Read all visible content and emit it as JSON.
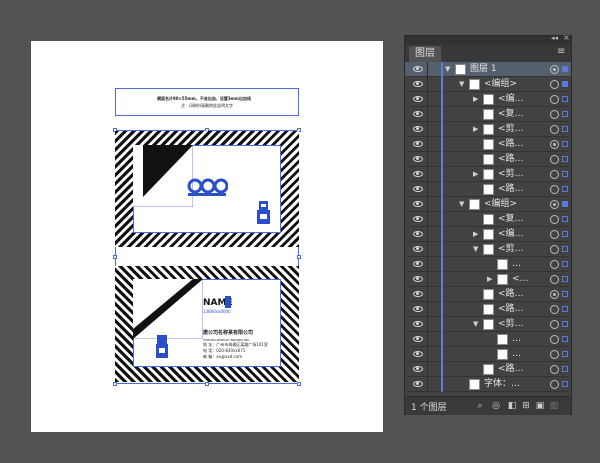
{
  "artboard": {
    "header_line1": "横版名片90×55mm，不含出血，设置3mm出血线",
    "header_line2": "注：印刷时请删除此说明文字",
    "card_name": "NAME",
    "card_phone_top": "13800xx0000",
    "company": "唐公司名称某有限公司",
    "company_en": "CERTAIN JEWELRY BRANDS INC.",
    "address": "地 址：广州市海珠区某路广场101室",
    "phone": "电 话：020-830xx671",
    "email": "邮 箱：xx@xxd.com"
  },
  "panel": {
    "topbar_left": "◂◂",
    "topbar_close": "×",
    "tab_label": "图层",
    "menu_icon": "≡",
    "layers": [
      {
        "name": "图层 1",
        "indent": 0,
        "arrow": "▼",
        "selected": true,
        "target": "filled",
        "sq": "filled"
      },
      {
        "name": "<编组>",
        "indent": 1,
        "arrow": "▼",
        "selected": false,
        "target": "empty",
        "sq": "filled"
      },
      {
        "name": "<编…",
        "indent": 2,
        "arrow": "▶",
        "selected": false,
        "target": "empty",
        "sq": "empty"
      },
      {
        "name": "<复…",
        "indent": 2,
        "arrow": "",
        "selected": false,
        "target": "empty",
        "sq": "empty"
      },
      {
        "name": "<剪…",
        "indent": 2,
        "arrow": "▶",
        "selected": false,
        "target": "empty",
        "sq": "empty"
      },
      {
        "name": "<路…",
        "indent": 2,
        "arrow": "",
        "selected": false,
        "target": "filled",
        "sq": "empty"
      },
      {
        "name": "<路…",
        "indent": 2,
        "arrow": "",
        "selected": false,
        "target": "empty",
        "sq": "empty"
      },
      {
        "name": "<剪…",
        "indent": 2,
        "arrow": "▶",
        "selected": false,
        "target": "empty",
        "sq": "empty"
      },
      {
        "name": "<路…",
        "indent": 2,
        "arrow": "",
        "selected": false,
        "target": "empty",
        "sq": "empty"
      },
      {
        "name": "<编组>",
        "indent": 1,
        "arrow": "▼",
        "selected": false,
        "target": "filled",
        "sq": "filled"
      },
      {
        "name": "<复…",
        "indent": 2,
        "arrow": "",
        "selected": false,
        "target": "empty",
        "sq": "empty"
      },
      {
        "name": "<编…",
        "indent": 2,
        "arrow": "▶",
        "selected": false,
        "target": "empty",
        "sq": "empty"
      },
      {
        "name": "<剪…",
        "indent": 2,
        "arrow": "▼",
        "selected": false,
        "target": "empty",
        "sq": "empty"
      },
      {
        "name": "…",
        "indent": 3,
        "arrow": "",
        "selected": false,
        "target": "empty",
        "sq": "empty"
      },
      {
        "name": "<…",
        "indent": 3,
        "arrow": "▶",
        "selected": false,
        "target": "empty",
        "sq": "empty"
      },
      {
        "name": "<路…",
        "indent": 2,
        "arrow": "",
        "selected": false,
        "target": "filled",
        "sq": "empty"
      },
      {
        "name": "<路…",
        "indent": 2,
        "arrow": "",
        "selected": false,
        "target": "empty",
        "sq": "empty"
      },
      {
        "name": "<剪…",
        "indent": 2,
        "arrow": "▼",
        "selected": false,
        "target": "empty",
        "sq": "empty"
      },
      {
        "name": "…",
        "indent": 3,
        "arrow": "",
        "selected": false,
        "target": "empty",
        "sq": "empty"
      },
      {
        "name": "…",
        "indent": 3,
        "arrow": "",
        "selected": false,
        "target": "empty",
        "sq": "empty"
      },
      {
        "name": "<路…",
        "indent": 2,
        "arrow": "",
        "selected": false,
        "target": "empty",
        "sq": "empty"
      },
      {
        "name": "字体：…",
        "indent": 1,
        "arrow": "",
        "selected": false,
        "target": "empty",
        "sq": "empty"
      }
    ],
    "footer_label": "1 个图层",
    "footer_icons": [
      "search-icon",
      "locate-icon",
      "make-clip-icon",
      "new-sublayer-icon",
      "new-layer-icon",
      "delete-icon"
    ]
  },
  "colors": {
    "workspace": "#535353",
    "selection": "#4a6ee0",
    "panel_bg": "#424242",
    "row_selected": "#55606e"
  }
}
